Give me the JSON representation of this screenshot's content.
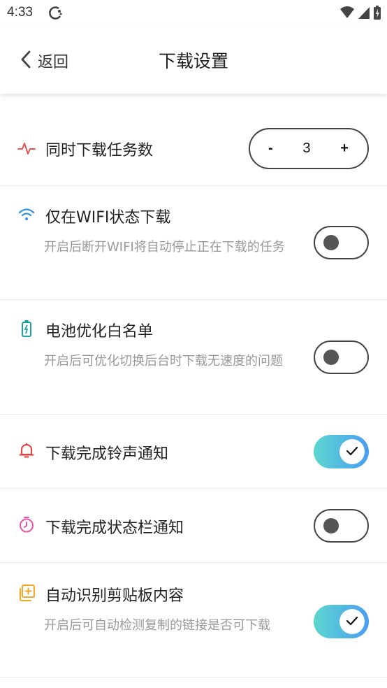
{
  "status_bar": {
    "time": "4:33"
  },
  "header": {
    "back_label": "返回",
    "title": "下载设置"
  },
  "settings": {
    "concurrent": {
      "title": "同时下载任务数",
      "minus": "-",
      "value": "3",
      "plus": "+"
    },
    "wifi_only": {
      "title": "仅在WIFI状态下载",
      "desc": "开启后断开WIFI将自动停止正在下载的任务",
      "enabled": false
    },
    "battery": {
      "title": "电池优化白名单",
      "desc": "开启后可优化切换后台时下载无速度的问题",
      "enabled": false
    },
    "ringtone": {
      "title": "下载完成铃声通知",
      "enabled": true
    },
    "statusbar": {
      "title": "下载完成状态栏通知",
      "enabled": false
    },
    "clipboard": {
      "title": "自动识别剪贴板内容",
      "desc": "开启后可自动检测复制的链接是否可下载",
      "enabled": true
    }
  },
  "colors": {
    "toggle_on_start": "#5cd6cf",
    "toggle_on_end": "#4a9ef2",
    "activity_icon": "#e05a52",
    "wifi_icon": "#2b8fe8",
    "battery_icon": "#1aa3a3",
    "bell_icon": "#e63b3b",
    "timer_icon": "#e653a8",
    "clipboard_icon": "#f5a623"
  },
  "icons": [
    "activity-icon",
    "wifi-icon",
    "battery-icon",
    "bell-icon",
    "timer-icon",
    "clipboard-add-icon"
  ]
}
